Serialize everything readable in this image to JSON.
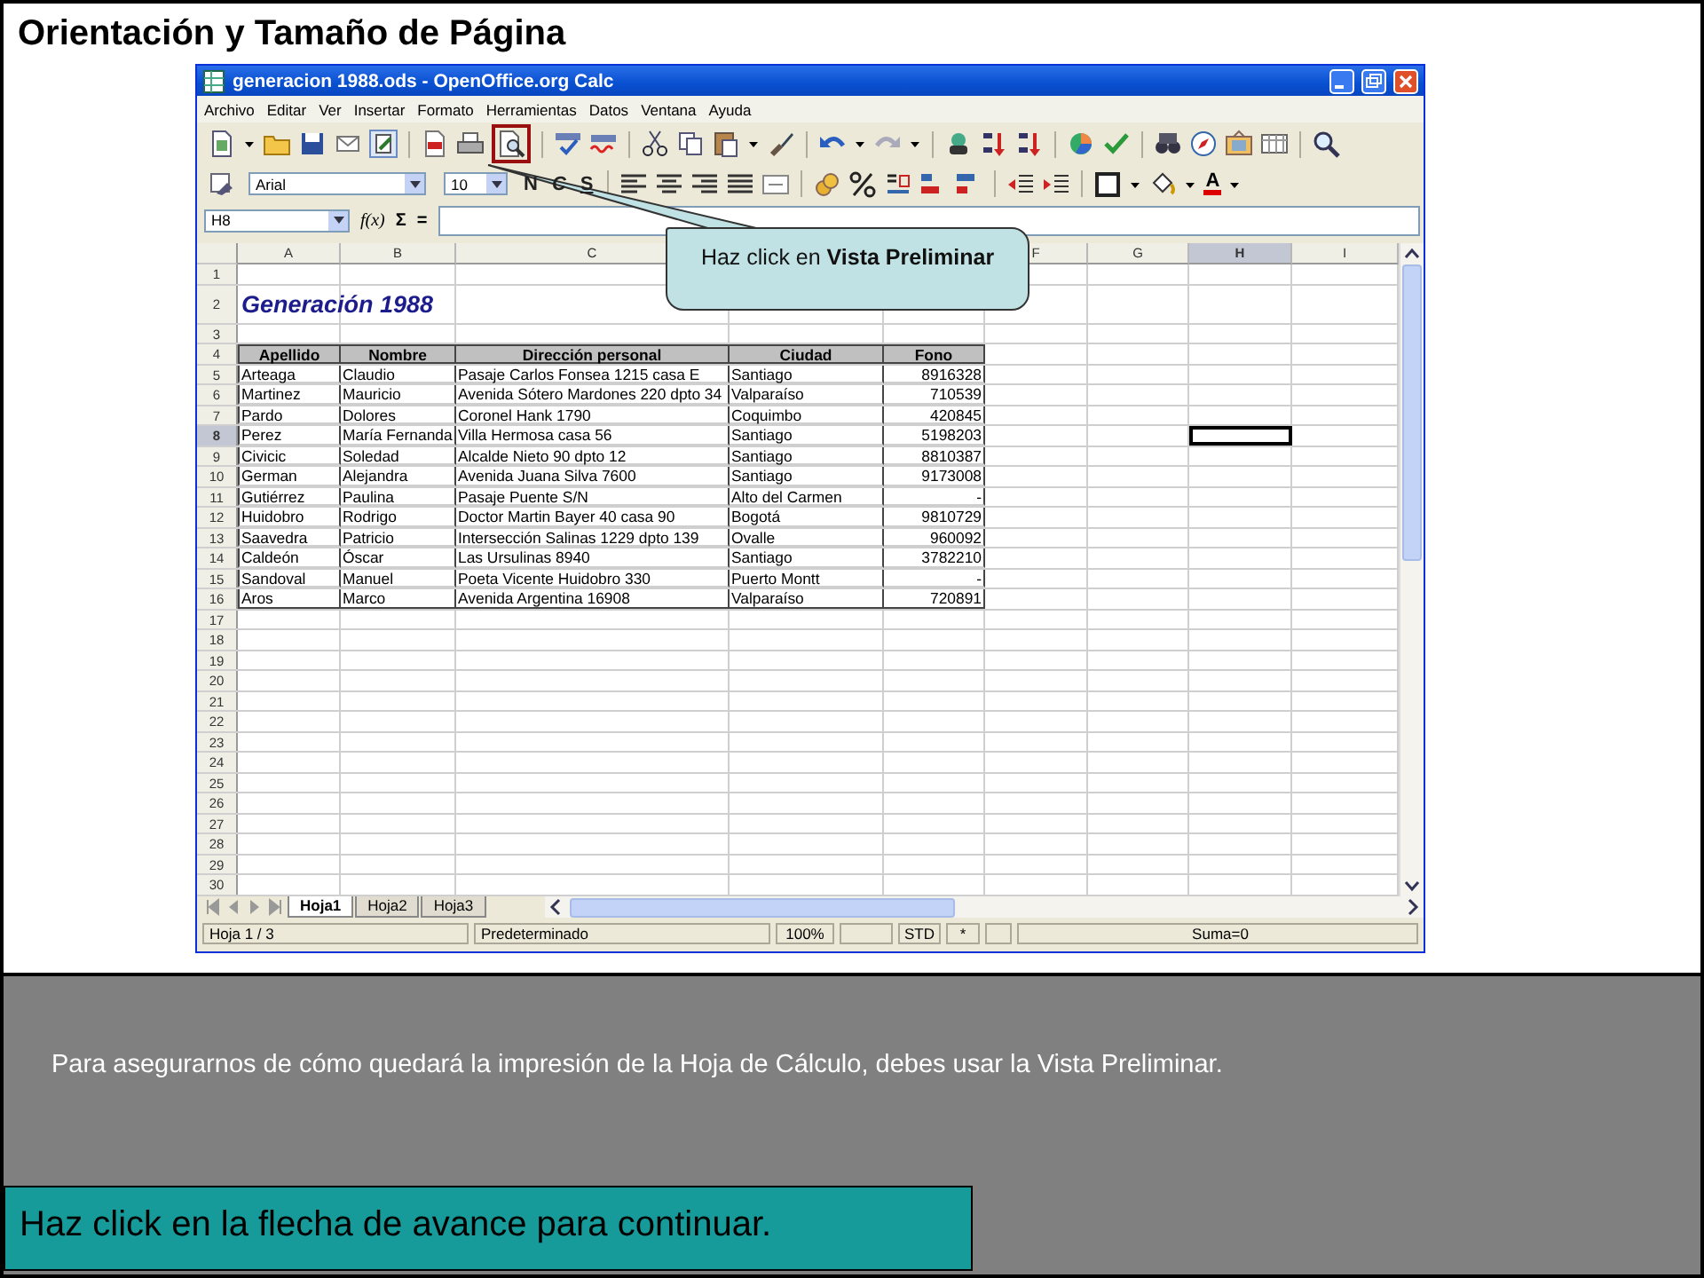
{
  "slide_title": "Orientación y Tamaño de Página",
  "window": {
    "title": "generacion 1988.ods - OpenOffice.org Calc"
  },
  "menu": [
    "Archivo",
    "Editar",
    "Ver",
    "Insertar",
    "Formato",
    "Herramientas",
    "Datos",
    "Ventana",
    "Ayuda"
  ],
  "standard_toolbar": [
    {
      "highlighted": false
    },
    {
      "highlighted": false
    },
    {
      "highlighted": false
    },
    {
      "highlighted": false
    },
    {
      "highlighted": false
    },
    {
      "highlighted": false
    },
    {
      "highlighted": false
    },
    {
      "highlighted": true
    },
    {
      "highlighted": false
    },
    {
      "highlighted": false
    },
    {
      "highlighted": false
    },
    {
      "highlighted": false
    },
    {
      "highlighted": false
    },
    {
      "highlighted": false
    },
    {
      "highlighted": false
    },
    {
      "highlighted": false
    },
    {
      "highlighted": false
    },
    {
      "highlighted": false
    },
    {
      "highlighted": false
    },
    {
      "highlighted": false
    },
    {
      "highlighted": false
    },
    {
      "highlighted": false
    },
    {
      "highlighted": false
    },
    {
      "highlighted": false
    },
    {
      "highlighted": false
    },
    {
      "highlighted": false
    }
  ],
  "format_toolbar": {
    "font": "Arial",
    "size": "10",
    "styles": [
      "N",
      "C",
      "S"
    ],
    "font_color_glyph": "A"
  },
  "formula_bar": {
    "name_box": "H8",
    "function_glyph": "f(x)",
    "sum_glyph": "Σ",
    "equals_glyph": "="
  },
  "columns": [
    {
      "label": "A",
      "selected": false
    },
    {
      "label": "B",
      "selected": false
    },
    {
      "label": "C",
      "selected": false
    },
    {
      "label": "F",
      "selected": false
    },
    {
      "label": "G",
      "selected": false
    },
    {
      "label": "H",
      "selected": true
    },
    {
      "label": "I",
      "selected": false
    }
  ],
  "rows": [
    {
      "number": "1",
      "kind": "blank",
      "selected": false
    },
    {
      "number": "2",
      "kind": "title",
      "selected": false,
      "title": "Generación 1988"
    },
    {
      "number": "3",
      "kind": "blank",
      "selected": false
    },
    {
      "number": "4",
      "kind": "header",
      "selected": false,
      "cells": [
        "Apellido",
        "Nombre",
        "Dirección personal",
        "Ciudad",
        "Fono"
      ]
    },
    {
      "number": "5",
      "kind": "data",
      "selected": false,
      "cells": [
        "Arteaga",
        "Claudio",
        "Pasaje Carlos Fonsea 1215 casa E",
        "Santiago",
        "8916328"
      ]
    },
    {
      "number": "6",
      "kind": "data",
      "selected": false,
      "cells": [
        "Martinez",
        "Mauricio",
        "Avenida Sótero Mardones 220 dpto 34",
        "Valparaíso",
        "710539"
      ]
    },
    {
      "number": "7",
      "kind": "data",
      "selected": false,
      "cells": [
        "Pardo",
        "Dolores",
        "Coronel Hank 1790",
        "Coquimbo",
        "420845"
      ]
    },
    {
      "number": "8",
      "kind": "data",
      "selected": true,
      "cells": [
        "Perez",
        "María Fernanda",
        "Villa Hermosa casa 56",
        "Santiago",
        "5198203"
      ]
    },
    {
      "number": "9",
      "kind": "data",
      "selected": false,
      "cells": [
        "Civicic",
        "Soledad",
        "Alcalde Nieto 90 dpto 12",
        "Santiago",
        "8810387"
      ]
    },
    {
      "number": "10",
      "kind": "data",
      "selected": false,
      "cells": [
        "German",
        "Alejandra",
        "Avenida Juana Silva 7600",
        "Santiago",
        "9173008"
      ]
    },
    {
      "number": "11",
      "kind": "data",
      "selected": false,
      "cells": [
        "Gutiérrez",
        "Paulina",
        "Pasaje Puente S/N",
        "Alto del Carmen",
        "-"
      ]
    },
    {
      "number": "12",
      "kind": "data",
      "selected": false,
      "cells": [
        "Huidobro",
        "Rodrigo",
        "Doctor Martin Bayer 40 casa 90",
        "Bogotá",
        "9810729"
      ]
    },
    {
      "number": "13",
      "kind": "data",
      "selected": false,
      "cells": [
        "Saavedra",
        "Patricio",
        "Intersección Salinas 1229 dpto 139",
        "Ovalle",
        "960092"
      ]
    },
    {
      "number": "14",
      "kind": "data",
      "selected": false,
      "cells": [
        "Caldeón",
        "Óscar",
        "Las Ursulinas 8940",
        "Santiago",
        "3782210"
      ]
    },
    {
      "number": "15",
      "kind": "data",
      "selected": false,
      "cells": [
        "Sandoval",
        "Manuel",
        "Poeta Vicente Huidobro 330",
        "Puerto Montt",
        "-"
      ]
    },
    {
      "number": "16",
      "kind": "data",
      "selected": false,
      "cells": [
        "Aros",
        "Marco",
        "Avenida Argentina 16908",
        "Valparaíso",
        "720891"
      ]
    },
    {
      "number": "17",
      "kind": "blank",
      "selected": false
    },
    {
      "number": "18",
      "kind": "blank",
      "selected": false
    },
    {
      "number": "19",
      "kind": "blank",
      "selected": false
    },
    {
      "number": "20",
      "kind": "blank",
      "selected": false
    },
    {
      "number": "21",
      "kind": "blank",
      "selected": false
    },
    {
      "number": "22",
      "kind": "blank",
      "selected": false
    },
    {
      "number": "23",
      "kind": "blank",
      "selected": false
    },
    {
      "number": "24",
      "kind": "blank",
      "selected": false
    },
    {
      "number": "25",
      "kind": "blank",
      "selected": false
    },
    {
      "number": "26",
      "kind": "blank",
      "selected": false
    },
    {
      "number": "27",
      "kind": "blank",
      "selected": false
    },
    {
      "number": "28",
      "kind": "blank",
      "selected": false
    },
    {
      "number": "29",
      "kind": "blank",
      "selected": false
    },
    {
      "number": "30",
      "kind": "blank",
      "selected": false
    }
  ],
  "sheet_tabs": [
    {
      "label": "Hoja1",
      "selected": true
    },
    {
      "label": "Hoja2",
      "selected": false
    },
    {
      "label": "Hoja3",
      "selected": false
    }
  ],
  "status_bar": [
    "Hoja 1 / 3",
    "Predeterminado",
    "100%",
    "STD",
    "*",
    "Suma=0"
  ],
  "callout": "Haz click en **Vista Preliminar**",
  "instruction": "Para asegurarnos de cómo quedará la impresión de la Hoja de Cálculo, debes usar la Vista Preliminar.",
  "next_hint": "Haz click en la flecha de avance para continuar."
}
